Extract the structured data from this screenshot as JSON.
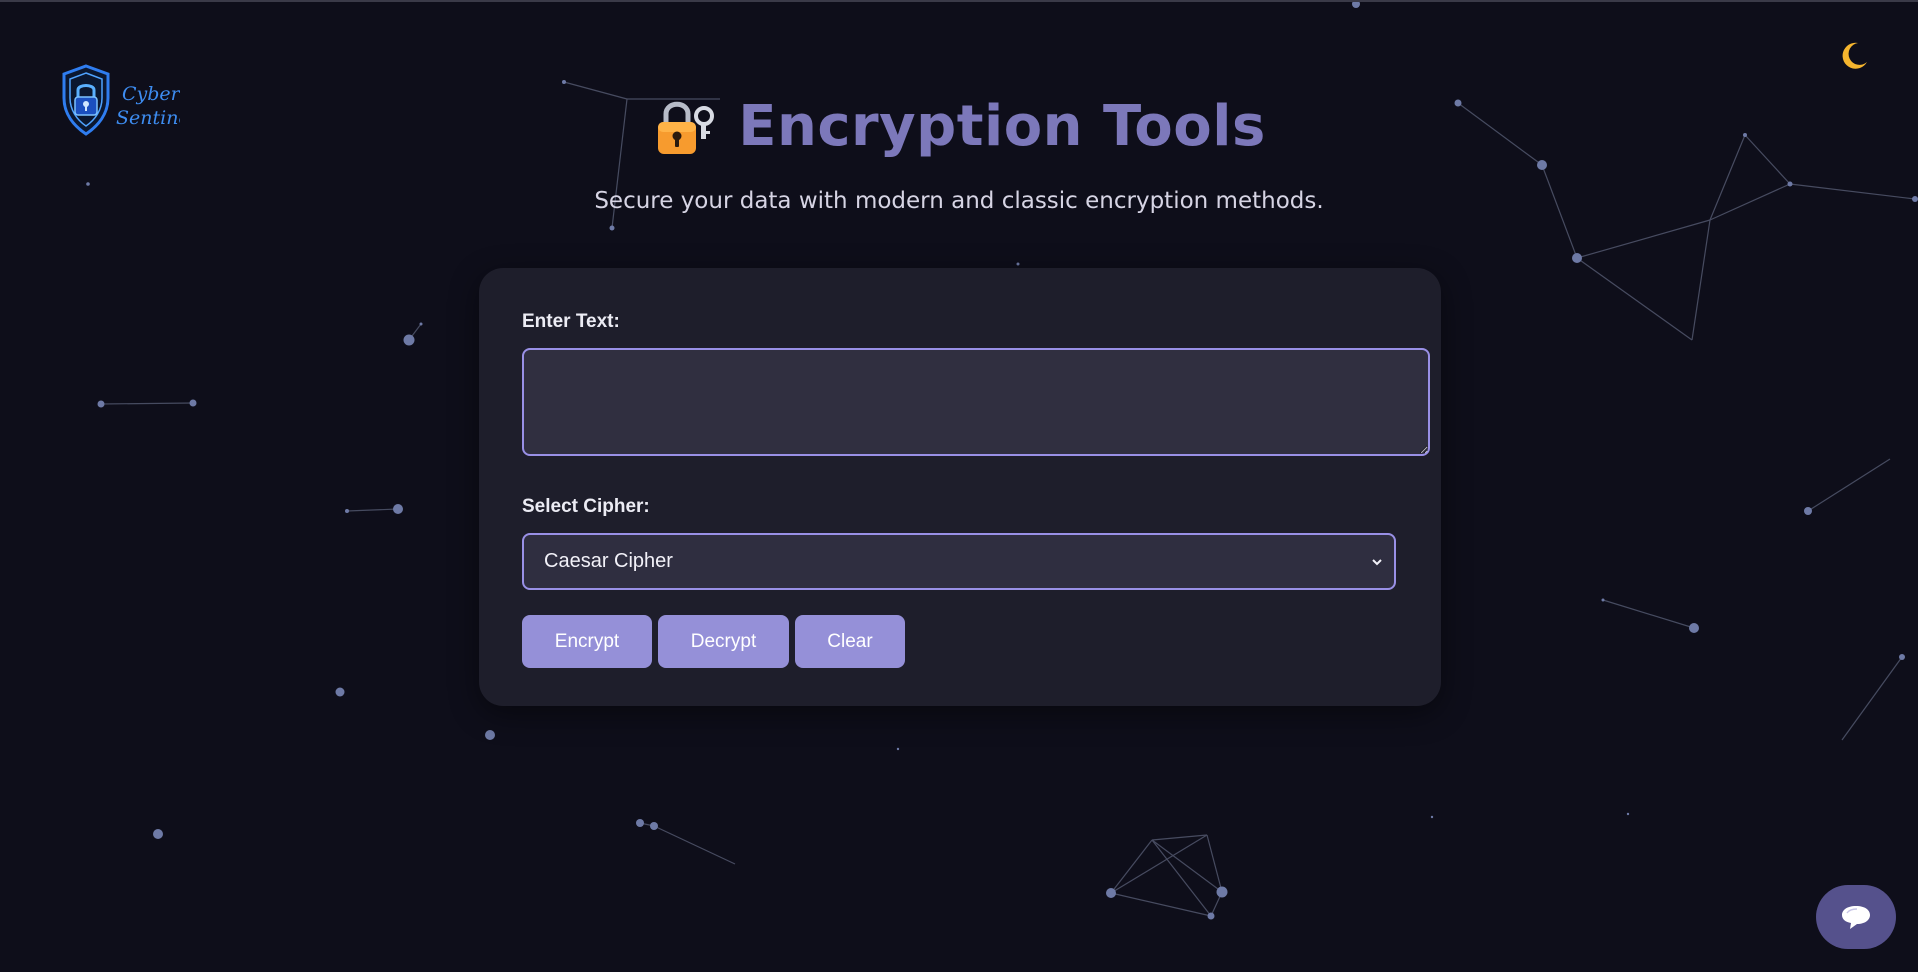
{
  "app": {
    "logo_text_line1": "Cyber",
    "logo_text_line2": "Sentinel",
    "theme_icon": "crescent-moon-icon"
  },
  "header": {
    "title_icon": "locked-with-key-icon",
    "title": "Encryption Tools",
    "subtitle": "Secure your data with modern and classic encryption methods."
  },
  "form": {
    "text_label": "Enter Text:",
    "text_value": "",
    "text_placeholder": "",
    "cipher_label": "Select Cipher:",
    "cipher_selected": "Caesar Cipher",
    "buttons": {
      "encrypt": "Encrypt",
      "decrypt": "Decrypt",
      "clear": "Clear"
    }
  },
  "chat": {
    "icon": "speech-bubble-icon"
  },
  "colors": {
    "background": "#0e0e1a",
    "card": "#1e1e2b",
    "accent": "#9590d8",
    "title": "#7c78ba",
    "chat_button": "#55518c",
    "logo_blue": "#2f7df0"
  }
}
